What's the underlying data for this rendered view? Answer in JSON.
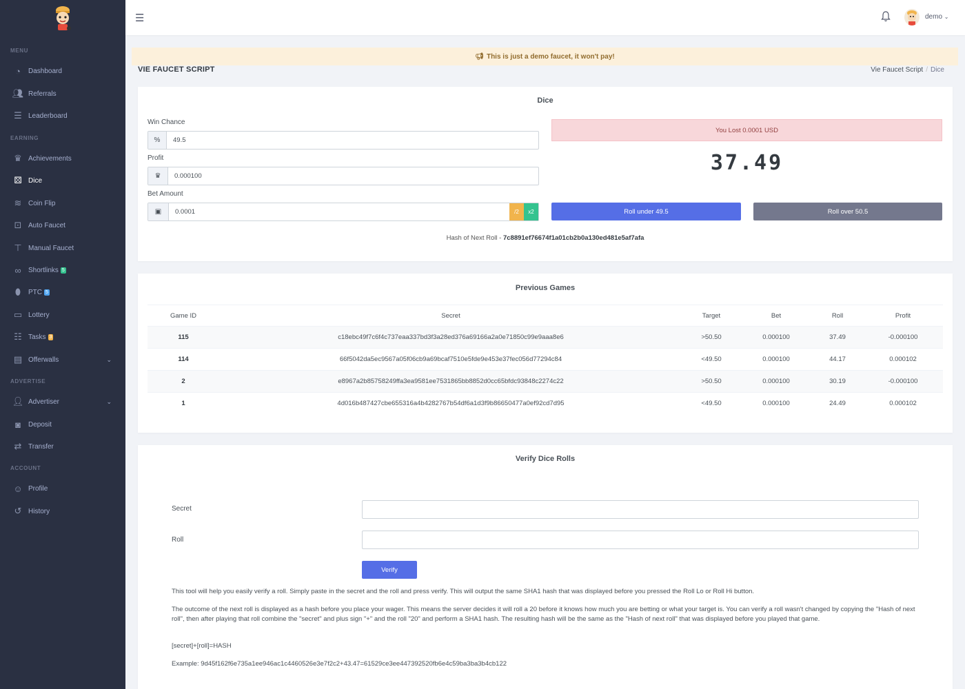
{
  "sidebar": {
    "sections": [
      "MENU",
      "EARNING",
      "ADVERTISE",
      "ACCOUNT"
    ],
    "items": [
      {
        "label": "Dashboard",
        "icon": "dashboard-icon"
      },
      {
        "label": "Referrals",
        "icon": "users-icon"
      },
      {
        "label": "Leaderboard",
        "icon": "list-icon"
      },
      {
        "label": "Achievements",
        "icon": "trophy-icon"
      },
      {
        "label": "Dice",
        "icon": "dice-icon"
      },
      {
        "label": "Coin Flip",
        "icon": "coins-icon"
      },
      {
        "label": "Auto Faucet",
        "icon": "robot-icon"
      },
      {
        "label": "Manual Faucet",
        "icon": "faucet-icon"
      },
      {
        "label": "Shortlinks",
        "icon": "link-icon",
        "badge": "5",
        "badge_color": "#34c38f"
      },
      {
        "label": "PTC",
        "icon": "mouse-icon",
        "badge": "5",
        "badge_color": "#50a5f1"
      },
      {
        "label": "Lottery",
        "icon": "ticket-icon"
      },
      {
        "label": "Tasks",
        "icon": "tasks-icon",
        "badge": "3",
        "badge_color": "#f1b44c"
      },
      {
        "label": "Offerwalls",
        "icon": "offerwall-icon"
      },
      {
        "label": "Advertiser",
        "icon": "advertiser-icon"
      },
      {
        "label": "Deposit",
        "icon": "deposit-icon"
      },
      {
        "label": "Transfer",
        "icon": "transfer-icon"
      },
      {
        "label": "Profile",
        "icon": "profile-icon"
      },
      {
        "label": "History",
        "icon": "history-icon"
      }
    ]
  },
  "topbar": {
    "username": "demo"
  },
  "alert": {
    "text": "This is just a demo faucet, it won't pay!"
  },
  "page": {
    "title": "VIE FAUCET SCRIPT",
    "breadcrumb": [
      "Vie Faucet Script",
      "Dice"
    ]
  },
  "dice": {
    "title": "Dice",
    "win_chance_label": "Win Chance",
    "win_chance_value": "49.5",
    "profit_label": "Profit",
    "profit_value": "0.000100",
    "bet_label": "Bet Amount",
    "bet_value": "0.0001",
    "half_label": "/2",
    "double_label": "x2",
    "result_text": "You Lost 0.0001 USD",
    "roll_number": "37.49",
    "roll_under_label": "Roll under 49.5",
    "roll_over_label": "Roll over 50.5",
    "hash_prefix": "Hash of Next Roll - ",
    "hash_value": "7c8891ef76674f1a01cb2b0a130ed481e5af7afa"
  },
  "previous": {
    "title": "Previous Games",
    "columns": [
      "Game ID",
      "Secret",
      "Target",
      "Bet",
      "Roll",
      "Profit"
    ],
    "rows": [
      [
        "115",
        "c18ebc49f7c6f4c737eaa337bd3f3a28ed376a69166a2a0e71850c99e9aaa8e6",
        ">50.50",
        "0.000100",
        "37.49",
        "-0.000100"
      ],
      [
        "114",
        "66f5042da5ec9567a05f06cb9a69bcaf7510e5fde9e453e37fec056d77294c84",
        "<49.50",
        "0.000100",
        "44.17",
        "0.000102"
      ],
      [
        "2",
        "e8967a2b85758249ffa3ea9581ee7531865bb8852d0cc65bfdc93848c2274c22",
        ">50.50",
        "0.000100",
        "30.19",
        "-0.000100"
      ],
      [
        "1",
        "4d016b487427cbe655316a4b4282767b54df6a1d3f9b86650477a0ef92cd7d95",
        "<49.50",
        "0.000100",
        "24.49",
        "0.000102"
      ]
    ]
  },
  "verify": {
    "title": "Verify Dice Rolls",
    "secret_label": "Secret",
    "roll_label": "Roll",
    "button_label": "Verify",
    "p1": "This tool will help you easily verify a roll. Simply paste in the secret and the roll and press verify. This will output the same SHA1 hash that was displayed before you pressed the Roll Lo or Roll Hi button.",
    "p2": "The outcome of the next roll is displayed as a hash before you place your wager. This means the server decides it will roll a 20 before it knows how much you are betting or what your target is. You can verify a roll wasn't changed by copying the \"Hash of next roll\", then after playing that roll combine the \"secret\" and plus sign \"+\" and the roll \"20\" and perform a SHA1 hash. The resulting hash will be the same as the \"Hash of next roll\" that was displayed before you played that game.",
    "p3": "[secret]+[roll]=HASH",
    "p4": "Example: 9d45f162f6e735a1ee946ac1c4460526e3e7f2c2+43.47=61529ce3ee447392520fb6e4c59ba3ba3b4cb122"
  },
  "colors": {
    "sidebar_bg": "#2a3042",
    "primary": "#556ee6",
    "secondary": "#74788d",
    "warning": "#f1b44c",
    "success": "#34c38f",
    "danger_bg": "#f8d7da"
  }
}
